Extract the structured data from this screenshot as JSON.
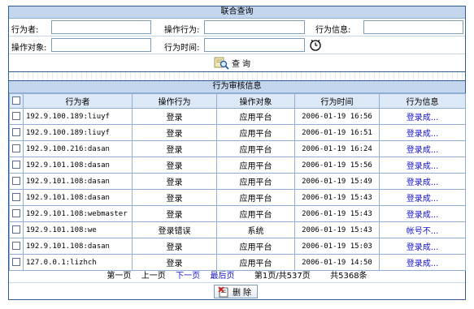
{
  "search": {
    "title": "联合查询",
    "actor_label": "行为者:",
    "action_label": "操作行为:",
    "info_label": "行为信息:",
    "object_label": "操作对象:",
    "time_label": "行为时间:",
    "actor_value": "",
    "action_value": "",
    "info_value": "",
    "object_value": "",
    "time_value": "",
    "query_icon": "search-magnifier-icon",
    "clock_icon": "clock-icon",
    "query_label": "查询"
  },
  "results": {
    "title": "行为审核信息",
    "columns": [
      "行为者",
      "操作行为",
      "操作对象",
      "行为时间",
      "行为信息"
    ],
    "rows": [
      {
        "actor": "192.9.100.189:liuyf",
        "action": "登录",
        "object": "应用平台",
        "time": "2006-01-19 16:56",
        "info": "登录成..."
      },
      {
        "actor": "192.9.100.189:liuyf",
        "action": "登录",
        "object": "应用平台",
        "time": "2006-01-19 16:51",
        "info": "登录成..."
      },
      {
        "actor": "192.9.100.216:dasan",
        "action": "登录",
        "object": "应用平台",
        "time": "2006-01-19 16:24",
        "info": "登录成..."
      },
      {
        "actor": "192.9.101.108:dasan",
        "action": "登录",
        "object": "应用平台",
        "time": "2006-01-19 15:56",
        "info": "登录成..."
      },
      {
        "actor": "192.9.101.108:dasan",
        "action": "登录",
        "object": "应用平台",
        "time": "2006-01-19 15:49",
        "info": "登录成..."
      },
      {
        "actor": "192.9.101.108:dasan",
        "action": "登录",
        "object": "应用平台",
        "time": "2006-01-19 15:43",
        "info": "登录成..."
      },
      {
        "actor": "192.9.101.108:webmaster",
        "action": "登录",
        "object": "应用平台",
        "time": "2006-01-19 15:43",
        "info": "登录成..."
      },
      {
        "actor": "192.9.101.108:we",
        "action": "登录错误",
        "object": "系统",
        "time": "2006-01-19 15:43",
        "info": "帐号不..."
      },
      {
        "actor": "192.9.101.108:dasan",
        "action": "登录",
        "object": "应用平台",
        "time": "2006-01-19 15:03",
        "info": "登录成..."
      },
      {
        "actor": "127.0.0.1:lizhch",
        "action": "登录",
        "object": "应用平台",
        "time": "2006-01-19 14:50",
        "info": "登录成..."
      }
    ]
  },
  "pager": {
    "first": "第一页",
    "prev": "上一页",
    "next": "下一页",
    "last": "最后页",
    "page_status": "第1页/共537页",
    "total": "共5368条"
  },
  "delete": {
    "label": "删除",
    "icon": "delete-icon"
  },
  "colors": {
    "border": "#2e5d96",
    "title_bg": "#c4d6ee",
    "header_bg": "#dde8f6",
    "link": "#1515c8"
  }
}
